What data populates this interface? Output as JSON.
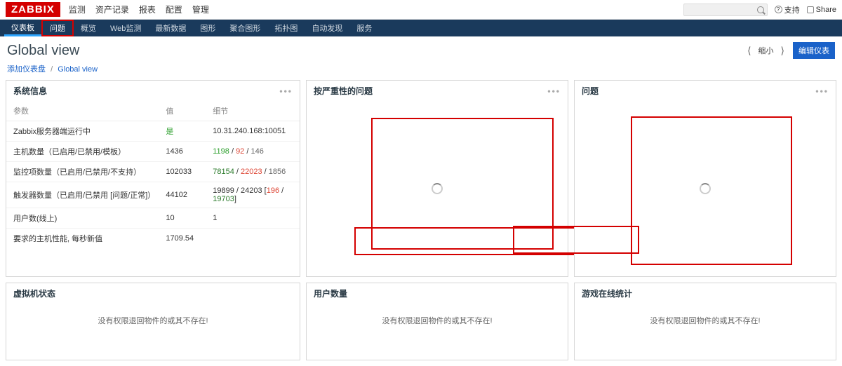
{
  "header": {
    "logo": "ZABBIX",
    "top_nav": [
      "监测",
      "资产记录",
      "报表",
      "配置",
      "管理"
    ],
    "help": "支持",
    "share": "Share"
  },
  "sub_nav": {
    "items": [
      "仪表板",
      "问题",
      "概览",
      "Web监测",
      "最新数据",
      "图形",
      "聚合图形",
      "拓扑图",
      "自动发现",
      "服务"
    ],
    "active_index": 0,
    "highlighted_index": 1
  },
  "title_row": {
    "title": "Global view",
    "edit_button": "编辑仪表",
    "zoom_label": "缩小"
  },
  "breadcrumb": {
    "link1": "添加仪表盘",
    "current": "Global view"
  },
  "widgets": {
    "system_info": {
      "title": "系统信息",
      "headers": [
        "参数",
        "值",
        "细节"
      ],
      "rows": [
        {
          "param": "Zabbix服务器端运行中",
          "value_html": [
            {
              "t": "是",
              "c": "g"
            }
          ],
          "detail_html": [
            {
              "t": "10.31.240.168:10051",
              "c": ""
            }
          ]
        },
        {
          "param": "主机数量（已启用/已禁用/模板）",
          "value_html": [
            {
              "t": "1436",
              "c": ""
            }
          ],
          "detail_html": [
            {
              "t": "1198",
              "c": "g"
            },
            {
              "t": " / ",
              "c": ""
            },
            {
              "t": "92",
              "c": "r"
            },
            {
              "t": " / ",
              "c": ""
            },
            {
              "t": "146",
              "c": "b"
            }
          ]
        },
        {
          "param": "监控项数量（已启用/已禁用/不支持）",
          "value_html": [
            {
              "t": "102033",
              "c": ""
            }
          ],
          "detail_html": [
            {
              "t": "78154",
              "c": "dg"
            },
            {
              "t": " / ",
              "c": ""
            },
            {
              "t": "22023",
              "c": "r"
            },
            {
              "t": " / ",
              "c": ""
            },
            {
              "t": "1856",
              "c": "b"
            }
          ]
        },
        {
          "param": "触发器数量（已启用/已禁用 [问题/正常]）",
          "value_html": [
            {
              "t": "44102",
              "c": ""
            }
          ],
          "detail_html": [
            {
              "t": "19899 / 24203 [",
              "c": ""
            },
            {
              "t": "196",
              "c": "r"
            },
            {
              "t": " / ",
              "c": ""
            },
            {
              "t": "19703",
              "c": "dg"
            },
            {
              "t": "]",
              "c": ""
            }
          ]
        },
        {
          "param": "用户数(线上)",
          "value_html": [
            {
              "t": "10",
              "c": ""
            }
          ],
          "detail_html": [
            {
              "t": "1",
              "c": ""
            }
          ]
        },
        {
          "param": "要求的主机性能, 每秒新值",
          "value_html": [
            {
              "t": "1709.54",
              "c": ""
            }
          ],
          "detail_html": []
        }
      ]
    },
    "severity": {
      "title": "按严重性的问题"
    },
    "problems": {
      "title": "问题"
    },
    "vm_status": {
      "title": "虚拟机状态",
      "no_perm": "没有权限退回物件的或其不存在!"
    },
    "user_count": {
      "title": "用户数量",
      "no_perm": "没有权限退回物件的或其不存在!"
    },
    "game_stats": {
      "title": "游戏在线统计",
      "no_perm": "没有权限退回物件的或其不存在!"
    }
  }
}
